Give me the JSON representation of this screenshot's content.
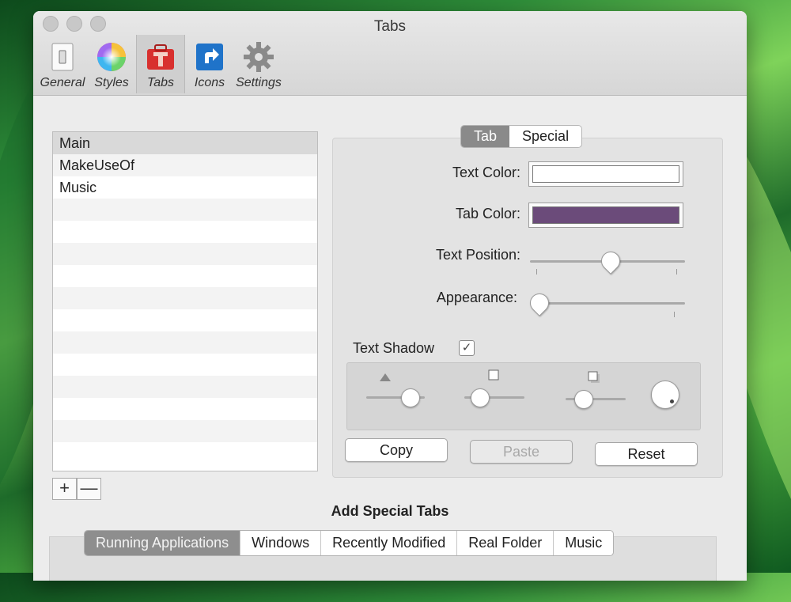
{
  "window": {
    "title": "Tabs"
  },
  "toolbar": {
    "items": [
      {
        "label": "General",
        "icon": "switch-icon"
      },
      {
        "label": "Styles",
        "icon": "color-wheel-icon"
      },
      {
        "label": "Tabs",
        "icon": "toolbox-icon",
        "selected": true
      },
      {
        "label": "Icons",
        "icon": "shortcut-arrow-icon"
      },
      {
        "label": "Settings",
        "icon": "gear-icon"
      }
    ]
  },
  "tab_list": {
    "items": [
      "Main",
      "MakeUseOf",
      "Music"
    ],
    "selected": "Main"
  },
  "list_controls": {
    "add": "+",
    "remove": "—"
  },
  "segmented": {
    "options": [
      "Tab",
      "Special"
    ],
    "selected": "Tab"
  },
  "fields": {
    "text_color_label": "Text Color:",
    "tab_color_label": "Tab Color:",
    "text_position_label": "Text Position:",
    "appearance_label": "Appearance:",
    "text_color": "#ffffff",
    "tab_color": "#6b4b7a",
    "text_position_value": 0.52,
    "appearance_value": 0.0
  },
  "text_shadow": {
    "label": "Text Shadow",
    "checked": true,
    "check_glyph": "✓",
    "slider_1_value": 0.85,
    "slider_2_value": 0.15,
    "slider_3_value": 0.2
  },
  "buttons": {
    "copy": "Copy",
    "paste": "Paste",
    "reset": "Reset"
  },
  "special": {
    "title": "Add Special Tabs",
    "options": [
      "Running Applications",
      "Windows",
      "Recently Modified",
      "Real Folder",
      "Music"
    ],
    "selected": "Running Applications"
  }
}
